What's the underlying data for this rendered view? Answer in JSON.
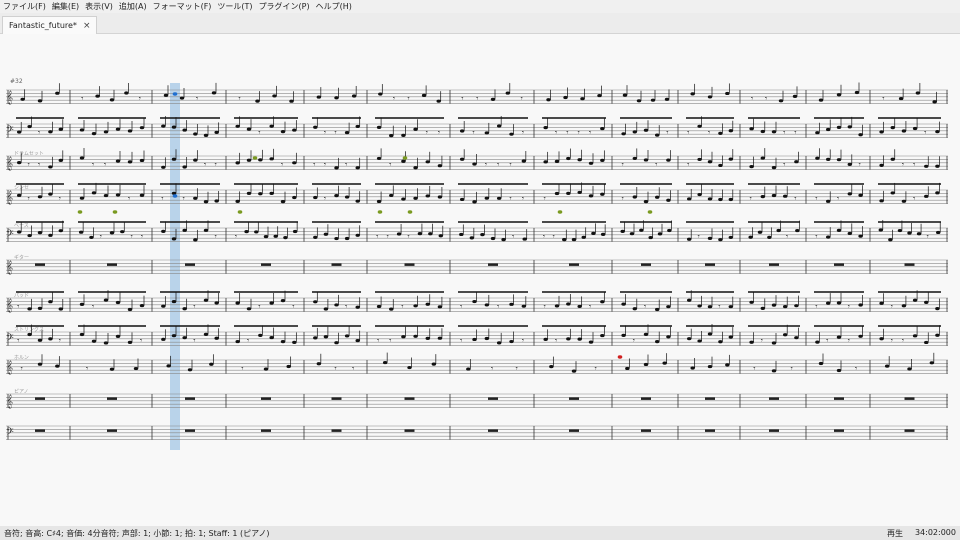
{
  "menu": [
    "ファイル(F)",
    "編集(E)",
    "表示(V)",
    "追加(A)",
    "フォーマット(F)",
    "ツール(T)",
    "プラグイン(P)",
    "ヘルプ(H)"
  ],
  "tab": {
    "title": "Fantastic_future*",
    "close_glyph": "×"
  },
  "score": {
    "measure_number": "#32",
    "staff_labels": [
      "ドラムセット",
      "シンセ",
      "ベース",
      "ギター",
      "パッド",
      "ストリングス",
      "ホルン",
      "ピアノ"
    ],
    "playback_highlight_color": "#b9d3ea",
    "accent_colors": {
      "selected": "#1f6fd0",
      "green_note": "#7a9a20",
      "red_note": "#d02020"
    }
  },
  "status": {
    "left": "音符; 音高: C♯4; 音価: 4分音符; 声部: 1; 小節: 1; 拍: 1; Staff: 1 (ピアノ)",
    "mode": "再生",
    "time": "34:02:000"
  }
}
